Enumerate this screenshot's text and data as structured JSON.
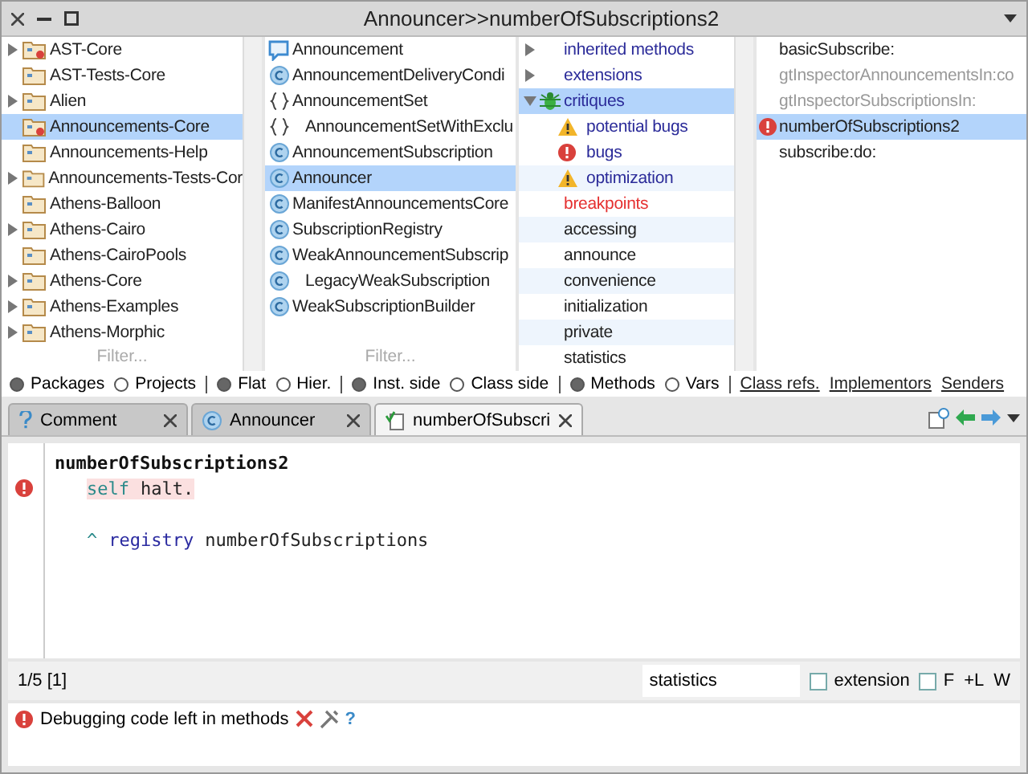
{
  "window": {
    "title": "Announcer>>numberOfSubscriptions2"
  },
  "packages": {
    "filter_placeholder": "Filter...",
    "items": [
      {
        "label": "AST-Core",
        "kind": "extended",
        "expandable": true,
        "selected": false
      },
      {
        "label": "AST-Tests-Core",
        "kind": "plain",
        "expandable": false,
        "selected": false
      },
      {
        "label": "Alien",
        "kind": "plain",
        "expandable": true,
        "selected": false
      },
      {
        "label": "Announcements-Core",
        "kind": "extended",
        "expandable": false,
        "selected": true
      },
      {
        "label": "Announcements-Help",
        "kind": "plain",
        "expandable": false,
        "selected": false
      },
      {
        "label": "Announcements-Tests-Cor",
        "kind": "plain",
        "expandable": true,
        "selected": false
      },
      {
        "label": "Athens-Balloon",
        "kind": "plain",
        "expandable": false,
        "selected": false
      },
      {
        "label": "Athens-Cairo",
        "kind": "plain",
        "expandable": true,
        "selected": false
      },
      {
        "label": "Athens-CairoPools",
        "kind": "plain",
        "expandable": false,
        "selected": false
      },
      {
        "label": "Athens-Core",
        "kind": "plain",
        "expandable": true,
        "selected": false
      },
      {
        "label": "Athens-Examples",
        "kind": "plain",
        "expandable": true,
        "selected": false
      },
      {
        "label": "Athens-Morphic",
        "kind": "plain",
        "expandable": true,
        "selected": false
      }
    ]
  },
  "classes": {
    "filter_placeholder": "Filter...",
    "items": [
      {
        "label": "Announcement",
        "kind": "commented",
        "selected": false
      },
      {
        "label": "AnnouncementDeliveryCondi",
        "kind": "class",
        "selected": false
      },
      {
        "label": "AnnouncementSet",
        "kind": "collection",
        "selected": false,
        "children": [
          {
            "label": "AnnouncementSetWithExclu",
            "kind": "collection",
            "selected": false
          }
        ]
      },
      {
        "label": "AnnouncementSubscription",
        "kind": "class",
        "selected": false
      },
      {
        "label": "Announcer",
        "kind": "class",
        "selected": true
      },
      {
        "label": "ManifestAnnouncementsCore",
        "kind": "class",
        "selected": false
      },
      {
        "label": "SubscriptionRegistry",
        "kind": "class",
        "selected": false
      },
      {
        "label": "WeakAnnouncementSubscrip",
        "kind": "class",
        "selected": false,
        "children": [
          {
            "label": "LegacyWeakSubscription",
            "kind": "class",
            "selected": false
          }
        ]
      },
      {
        "label": "WeakSubscriptionBuilder",
        "kind": "class",
        "selected": false
      }
    ]
  },
  "protocols": {
    "items": [
      {
        "label": "inherited methods",
        "kind": "group",
        "expanded": false,
        "selected": false
      },
      {
        "label": "extensions",
        "kind": "group",
        "expanded": false,
        "selected": false
      },
      {
        "label": "critiques",
        "kind": "critiques",
        "expanded": true,
        "selected": true,
        "children": [
          {
            "label": "potential bugs",
            "kind": "warning",
            "selected": false
          },
          {
            "label": "bugs",
            "kind": "error",
            "selected": false
          },
          {
            "label": "optimization",
            "kind": "warning",
            "selected": false
          }
        ]
      },
      {
        "label": "breakpoints",
        "kind": "breakpoints",
        "selected": false
      },
      {
        "label": "accessing",
        "kind": "protocol",
        "selected": false
      },
      {
        "label": "announce",
        "kind": "protocol",
        "selected": false
      },
      {
        "label": "convenience",
        "kind": "protocol",
        "selected": false
      },
      {
        "label": "initialization",
        "kind": "protocol",
        "selected": false
      },
      {
        "label": "private",
        "kind": "protocol",
        "selected": false
      },
      {
        "label": "statistics",
        "kind": "protocol",
        "selected": false
      }
    ]
  },
  "methods": {
    "items": [
      {
        "label": "basicSubscribe:",
        "dimmed": false,
        "error": false,
        "selected": false
      },
      {
        "label": "gtInspectorAnnouncementsIn:co",
        "dimmed": true,
        "error": false,
        "selected": false
      },
      {
        "label": "gtInspectorSubscriptionsIn:",
        "dimmed": true,
        "error": false,
        "selected": false
      },
      {
        "label": "numberOfSubscriptions2",
        "dimmed": false,
        "error": true,
        "selected": true
      },
      {
        "label": "subscribe:do:",
        "dimmed": false,
        "error": false,
        "selected": false
      }
    ]
  },
  "options": {
    "groups": [
      [
        {
          "label": "Packages",
          "selected": true
        },
        {
          "label": "Projects",
          "selected": false
        }
      ],
      [
        {
          "label": "Flat",
          "selected": true
        },
        {
          "label": "Hier.",
          "selected": false
        }
      ],
      [
        {
          "label": "Inst. side",
          "selected": true
        },
        {
          "label": "Class side",
          "selected": false
        }
      ],
      [
        {
          "label": "Methods",
          "selected": true
        },
        {
          "label": "Vars",
          "selected": false
        }
      ]
    ],
    "links": [
      "Class refs.",
      "Implementors",
      "Senders"
    ]
  },
  "tabs": [
    {
      "label": "Comment",
      "kind": "comment",
      "selected": false
    },
    {
      "label": "Announcer",
      "kind": "class",
      "selected": false
    },
    {
      "label": "numberOfSubscri",
      "kind": "method",
      "selected": true
    }
  ],
  "editor": {
    "lines": [
      {
        "kind": "signature",
        "marker": false,
        "highlighted": false,
        "tokens": [
          {
            "text": "numberOfSubscriptions2",
            "kind": "selector"
          }
        ]
      },
      {
        "kind": "statement",
        "marker": true,
        "highlighted": true,
        "tokens": [
          {
            "text": "self",
            "kind": "pseudo"
          },
          {
            "text": "halt.",
            "kind": "message"
          }
        ]
      },
      {
        "kind": "blank"
      },
      {
        "kind": "statement",
        "marker": false,
        "highlighted": false,
        "tokens": [
          {
            "text": "^",
            "kind": "pseudo"
          },
          {
            "text": "registry",
            "kind": "variable"
          },
          {
            "text": "numberOfSubscriptions",
            "kind": "message"
          }
        ]
      }
    ]
  },
  "status": {
    "position": "1/5 [1]",
    "protocol_value": "statistics",
    "checkboxes": [
      {
        "label": "extension",
        "checked": false
      },
      {
        "label": "F",
        "checked": false
      }
    ],
    "flags": [
      "+L",
      "W"
    ]
  },
  "critique": {
    "text": "Debugging code left in methods",
    "help": "?"
  }
}
